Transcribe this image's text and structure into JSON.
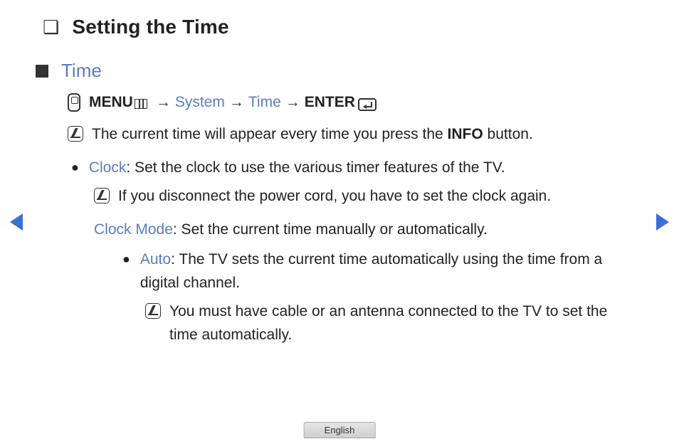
{
  "title": "Setting the Time",
  "section": "Time",
  "path": {
    "menu_label": "MENU",
    "system": "System",
    "time": "Time",
    "enter": "ENTER",
    "arrow": "→"
  },
  "info_note": {
    "pre": "The current time will appear every time you press the ",
    "bold": "INFO",
    "post": " button."
  },
  "clock": {
    "label": "Clock",
    "desc": ": Set the clock to use the various timer features of the TV.",
    "note": "If you disconnect the power cord, you have to set the clock again."
  },
  "clock_mode": {
    "label": "Clock Mode",
    "desc": ": Set the current time manually or automatically.",
    "auto": {
      "label": "Auto",
      "desc": ": The TV sets the current time automatically using the time from a digital channel.",
      "note": "You must have cable or an antenna connected to the TV to set the time automatically."
    }
  },
  "language": "English"
}
